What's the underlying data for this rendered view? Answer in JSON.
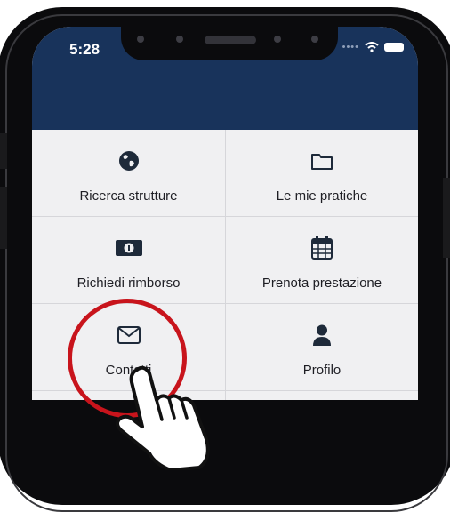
{
  "status_bar": {
    "time": "5:28"
  },
  "menu": {
    "items": [
      {
        "label": "Ricerca strutture",
        "icon": "globe-icon"
      },
      {
        "label": "Le mie pratiche",
        "icon": "folder-icon"
      },
      {
        "label": "Richiedi rimborso",
        "icon": "money-icon"
      },
      {
        "label": "Prenota prestazione",
        "icon": "calendar-icon"
      },
      {
        "label": "Contatti",
        "icon": "envelope-icon"
      },
      {
        "label": "Profilo",
        "icon": "user-icon"
      }
    ]
  },
  "colors": {
    "header": "#18335b",
    "highlight": "#c8141c",
    "background": "#f0f0f2"
  }
}
